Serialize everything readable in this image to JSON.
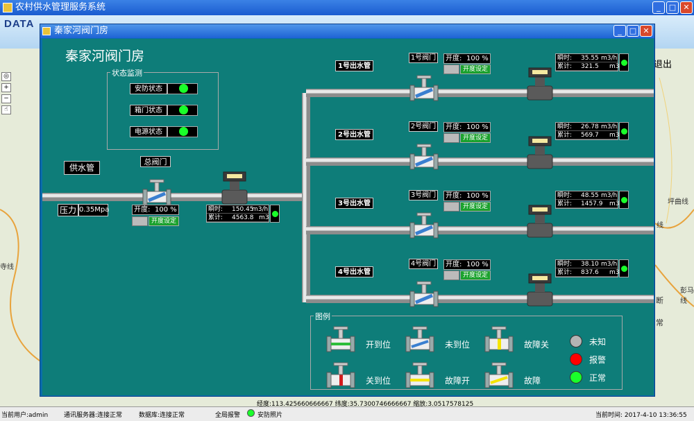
{
  "app": {
    "title": "农村供水管理服务系统",
    "brand": "DATA",
    "exit": "退出"
  },
  "map_labels": {
    "side1": "断",
    "side2": "常",
    "road1": "坪曲线",
    "road2": "线",
    "road3": "寺线",
    "road4": "彭马线"
  },
  "dialog": {
    "title": "秦家河阀门房",
    "heading": "秦家河阀门房"
  },
  "status_panel": {
    "title": "状态监测",
    "rows": [
      {
        "label": "安防状态",
        "color": "#1aff2a"
      },
      {
        "label": "箱门状态",
        "color": "#1aff2a"
      },
      {
        "label": "电源状态",
        "color": "#1aff2a"
      }
    ]
  },
  "main": {
    "pipe_label": "供水管",
    "valve_label": "总阀门",
    "pressure_label": "压力",
    "pressure_value": "0.35Mpa",
    "open_label": "开度:",
    "open_value": "100 %",
    "set_button": "开度设定",
    "flow": {
      "inst_label": "瞬时:",
      "inst_value": "150.45",
      "inst_unit": "m3/h",
      "total_label": "累计:",
      "total_value": "4563.8",
      "total_unit": "m3"
    }
  },
  "outlets": [
    {
      "name": "1号出水管",
      "valve": "1号阀门",
      "open_label": "开度:",
      "open_value": "100 %",
      "set_button": "开度设定",
      "inst_label": "瞬时:",
      "inst_value": "35.55",
      "inst_unit": "m3/h",
      "total_label": "累计:",
      "total_value": "321.5",
      "total_unit": "m3"
    },
    {
      "name": "2号出水管",
      "valve": "2号阀门",
      "open_label": "开度:",
      "open_value": "100 %",
      "set_button": "开度设定",
      "inst_label": "瞬时:",
      "inst_value": "26.78",
      "inst_unit": "m3/h",
      "total_label": "累计:",
      "total_value": "569.7",
      "total_unit": "m3"
    },
    {
      "name": "3号出水管",
      "valve": "3号阀门",
      "open_label": "开度:",
      "open_value": "100 %",
      "set_button": "开度设定",
      "inst_label": "瞬时:",
      "inst_value": "48.55",
      "inst_unit": "m3/h",
      "total_label": "累计:",
      "total_value": "1457.9",
      "total_unit": "m3"
    },
    {
      "name": "4号出水管",
      "valve": "4号阀门",
      "open_label": "开度:",
      "open_value": "100 %",
      "set_button": "开度设定",
      "inst_label": "瞬时:",
      "inst_value": "38.10",
      "inst_unit": "m3/h",
      "total_label": "累计:",
      "total_value": "837.6",
      "total_unit": "m3"
    }
  ],
  "legend": {
    "title": "图例",
    "items": [
      {
        "label": "开到位",
        "color": "#2ebd3a"
      },
      {
        "label": "未到位",
        "color": "#3a7fd0"
      },
      {
        "label": "故障关",
        "color": "#f5e400"
      },
      {
        "label": "关到位",
        "color": "#d21c1c"
      },
      {
        "label": "故障开",
        "color": "#f5e400"
      },
      {
        "label": "故障",
        "color": "#f5e400"
      }
    ],
    "lights": [
      {
        "label": "未知",
        "color": "#b4b4b4"
      },
      {
        "label": "报警",
        "color": "#ff0000"
      },
      {
        "label": "正常",
        "color": "#1aff2a"
      }
    ]
  },
  "coords": "经度:113.425660666667 纬度:35.7300746666667 缩放:3.0517578125",
  "statusbar": {
    "user": "当前用户:admin",
    "comm": "通讯服务器:连接正常",
    "db": "数据库:连接正常",
    "alarm": "全局报警",
    "photo": "安防照片",
    "time": "当前时间: 2017-4-10 13:36:55"
  }
}
